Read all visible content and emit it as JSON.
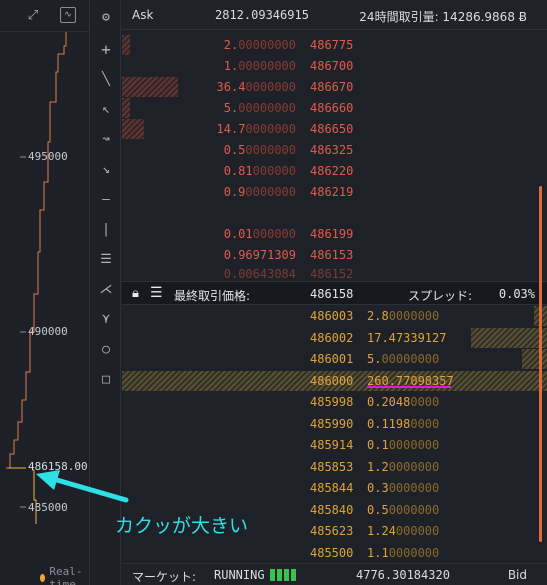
{
  "colors": {
    "ask": "#e25a4a",
    "bid": "#e0a23a",
    "annotation": "#2ee0e6",
    "highlight_underline": "#d620d0",
    "running_indicator": "#3cc24a"
  },
  "chart": {
    "price_labels": [
      "495000",
      "490000",
      "485000"
    ],
    "last_price_label": "486158.00",
    "realtime_label": "Real-time"
  },
  "chart_toolbar": {
    "icons": [
      "expand-icon",
      "chart-style-icon",
      "settings-gear-icon"
    ]
  },
  "drawing_tools": [
    "crosshair-icon",
    "trend-line-icon",
    "ray-icon",
    "curve-icon",
    "arrow-icon",
    "horizontal-line-icon",
    "vertical-line-icon",
    "parallel-channel-icon",
    "pitchfork-icon",
    "fib-tool-icon",
    "circle-icon",
    "rectangle-icon"
  ],
  "orderbook": {
    "header": {
      "title": "Ask",
      "ask_total": "2812.09346915",
      "volume_label": "24時間取引量: 14286.9868 Ƀ"
    },
    "asks": [
      {
        "amount_main": "2.",
        "amount_dim": "00000000",
        "price": "486775",
        "depth": 0.02
      },
      {
        "amount_main": "1.",
        "amount_dim": "00000000",
        "price": "486700",
        "depth": 0.0
      },
      {
        "amount_main": "36.4",
        "amount_dim": "0000000",
        "price": "486670",
        "depth": 0.35
      },
      {
        "amount_main": "5.",
        "amount_dim": "00000000",
        "price": "486660",
        "depth": 0.05
      },
      {
        "amount_main": "14.7",
        "amount_dim": "0000000",
        "price": "486650",
        "depth": 0.14
      },
      {
        "amount_main": "0.5",
        "amount_dim": "0000000",
        "price": "486325",
        "depth": 0.0
      },
      {
        "amount_main": "0.81",
        "amount_dim": "000000",
        "price": "486220",
        "depth": 0.0
      },
      {
        "amount_main": "0.9",
        "amount_dim": "0000000",
        "price": "486219",
        "depth": 0.0
      },
      {
        "amount_main": "",
        "amount_dim": "",
        "price": "",
        "depth": 0.0
      },
      {
        "amount_main": "0.01",
        "amount_dim": "000000",
        "price": "486199",
        "depth": 0.0
      },
      {
        "amount_main": "0.96971309",
        "amount_dim": "",
        "price": "486153",
        "depth": 0.0
      },
      {
        "amount_main": "0.00643084",
        "amount_dim": "",
        "price": "486152",
        "depth": 0.0
      }
    ],
    "spread_bar": {
      "last_price_label": "最終取引価格:",
      "last_price": "486158",
      "spread_label": "スプレッド:",
      "spread_value": "0.03%"
    },
    "bids": [
      {
        "price": "486003",
        "amount_main": "2.8",
        "amount_dim": "0000000",
        "depth": 0.03
      },
      {
        "price": "486002",
        "amount_main": "17.47339127",
        "amount_dim": "",
        "depth": 0.18
      },
      {
        "price": "486001",
        "amount_main": "5.",
        "amount_dim": "00000000",
        "depth": 0.06
      },
      {
        "price": "486000",
        "amount_main": "260.77098357",
        "amount_dim": "",
        "depth": 1.0
      },
      {
        "price": "485998",
        "amount_main": "0.2048",
        "amount_dim": "0000",
        "depth": 0.0
      },
      {
        "price": "485990",
        "amount_main": "0.1198",
        "amount_dim": "0000",
        "depth": 0.0
      },
      {
        "price": "485914",
        "amount_main": "0.1",
        "amount_dim": "0000000",
        "depth": 0.0
      },
      {
        "price": "485853",
        "amount_main": "1.2",
        "amount_dim": "0000000",
        "depth": 0.0
      },
      {
        "price": "485844",
        "amount_main": "0.3",
        "amount_dim": "0000000",
        "depth": 0.0
      },
      {
        "price": "485840",
        "amount_main": "0.5",
        "amount_dim": "0000000",
        "depth": 0.0
      },
      {
        "price": "485623",
        "amount_main": "1.24",
        "amount_dim": "000000",
        "depth": 0.0
      },
      {
        "price": "485500",
        "amount_main": "1.1",
        "amount_dim": "0000000",
        "depth": 0.0
      }
    ],
    "footer": {
      "market_label": "マーケット:",
      "market_status": "RUNNING",
      "bid_total": "4776.30184320",
      "bid_title": "Bid"
    }
  },
  "annotation": {
    "text": "カクッが大きい"
  }
}
